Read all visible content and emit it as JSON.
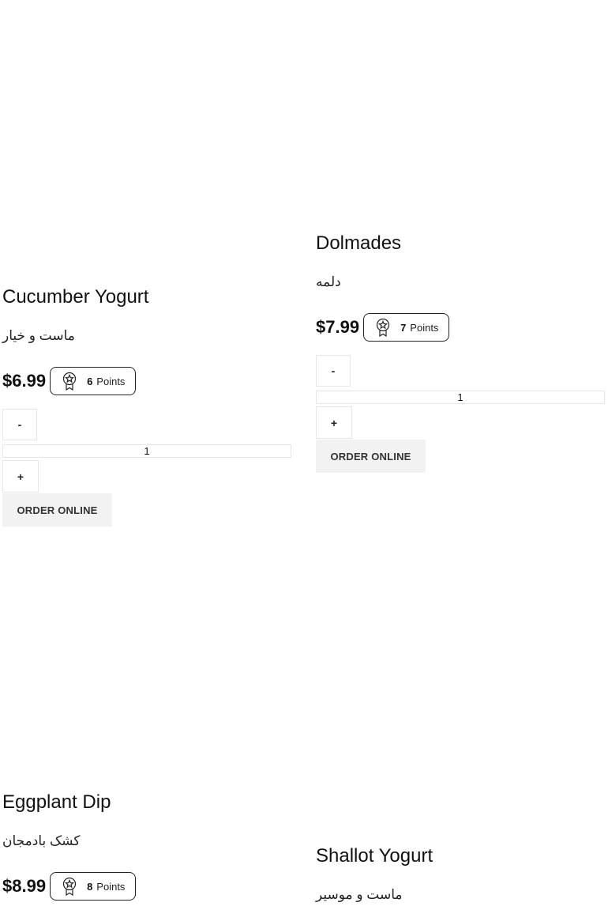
{
  "products": [
    {
      "name": "Cucumber Yogurt",
      "subtitle": "ماست و خیار",
      "price": "$6.99",
      "points": "6",
      "points_label": "Points",
      "qty_minus": "-",
      "qty_plus": "+",
      "quantity": "1",
      "order_label": "ORDER ONLINE"
    },
    {
      "name": "Dolmades",
      "subtitle": "دلمه",
      "price": "$7.99",
      "points": "7",
      "points_label": "Points",
      "qty_minus": "-",
      "qty_plus": "+",
      "quantity": "1",
      "order_label": "ORDER ONLINE"
    },
    {
      "name": "Eggplant Dip",
      "subtitle": "کشک بادمجان",
      "price": "$8.99",
      "points": "8",
      "points_label": "Points"
    },
    {
      "name": "Shallot Yogurt",
      "subtitle": "ماست و موسیر"
    }
  ],
  "icons": {
    "points": "award-badge-icon"
  }
}
